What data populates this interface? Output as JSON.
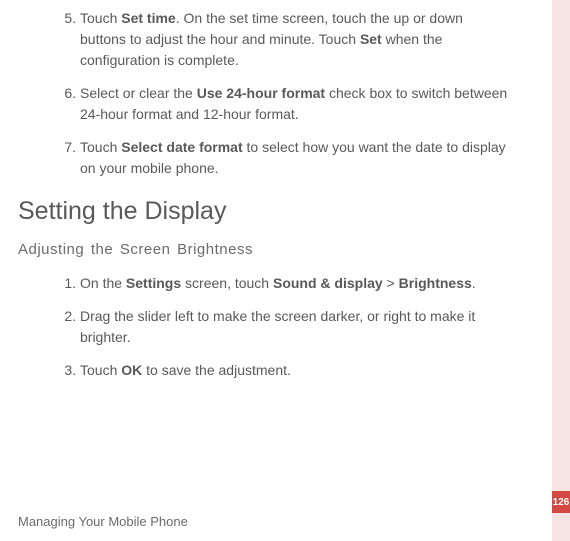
{
  "steps_a": [
    {
      "n": "5.",
      "pre": "Touch ",
      "b1": "Set time",
      "mid": ". On the set time screen, touch the up or down buttons to adjust the hour and minute. Touch ",
      "b2": "Set",
      "post": " when the configuration is complete."
    },
    {
      "n": "6.",
      "pre": "Select or clear the ",
      "b1": "Use 24-hour format",
      "mid": " check box to switch between 24-hour format and 12-hour format.",
      "b2": "",
      "post": ""
    },
    {
      "n": "7.",
      "pre": "Touch ",
      "b1": "Select date format",
      "mid": " to select how you want the date to display on your mobile phone.",
      "b2": "",
      "post": ""
    }
  ],
  "section_heading": "Setting the Display",
  "subheading": "Adjusting the Screen Brightness",
  "steps_b": [
    {
      "n": "1.",
      "pre": "On the ",
      "b1": "Settings",
      "mid": " screen, touch ",
      "b2": "Sound & display",
      "post1": " > ",
      "b3": "Brightness",
      "post2": "."
    },
    {
      "n": "2.",
      "pre": "Drag the slider left to make the screen darker, or right to make it brighter.",
      "b1": "",
      "mid": "",
      "b2": "",
      "post1": "",
      "b3": "",
      "post2": ""
    },
    {
      "n": "3.",
      "pre": "Touch ",
      "b1": "OK",
      "mid": " to save the adjustment.",
      "b2": "",
      "post1": "",
      "b3": "",
      "post2": ""
    }
  ],
  "footer": "Managing Your Mobile Phone",
  "page_num": "126"
}
